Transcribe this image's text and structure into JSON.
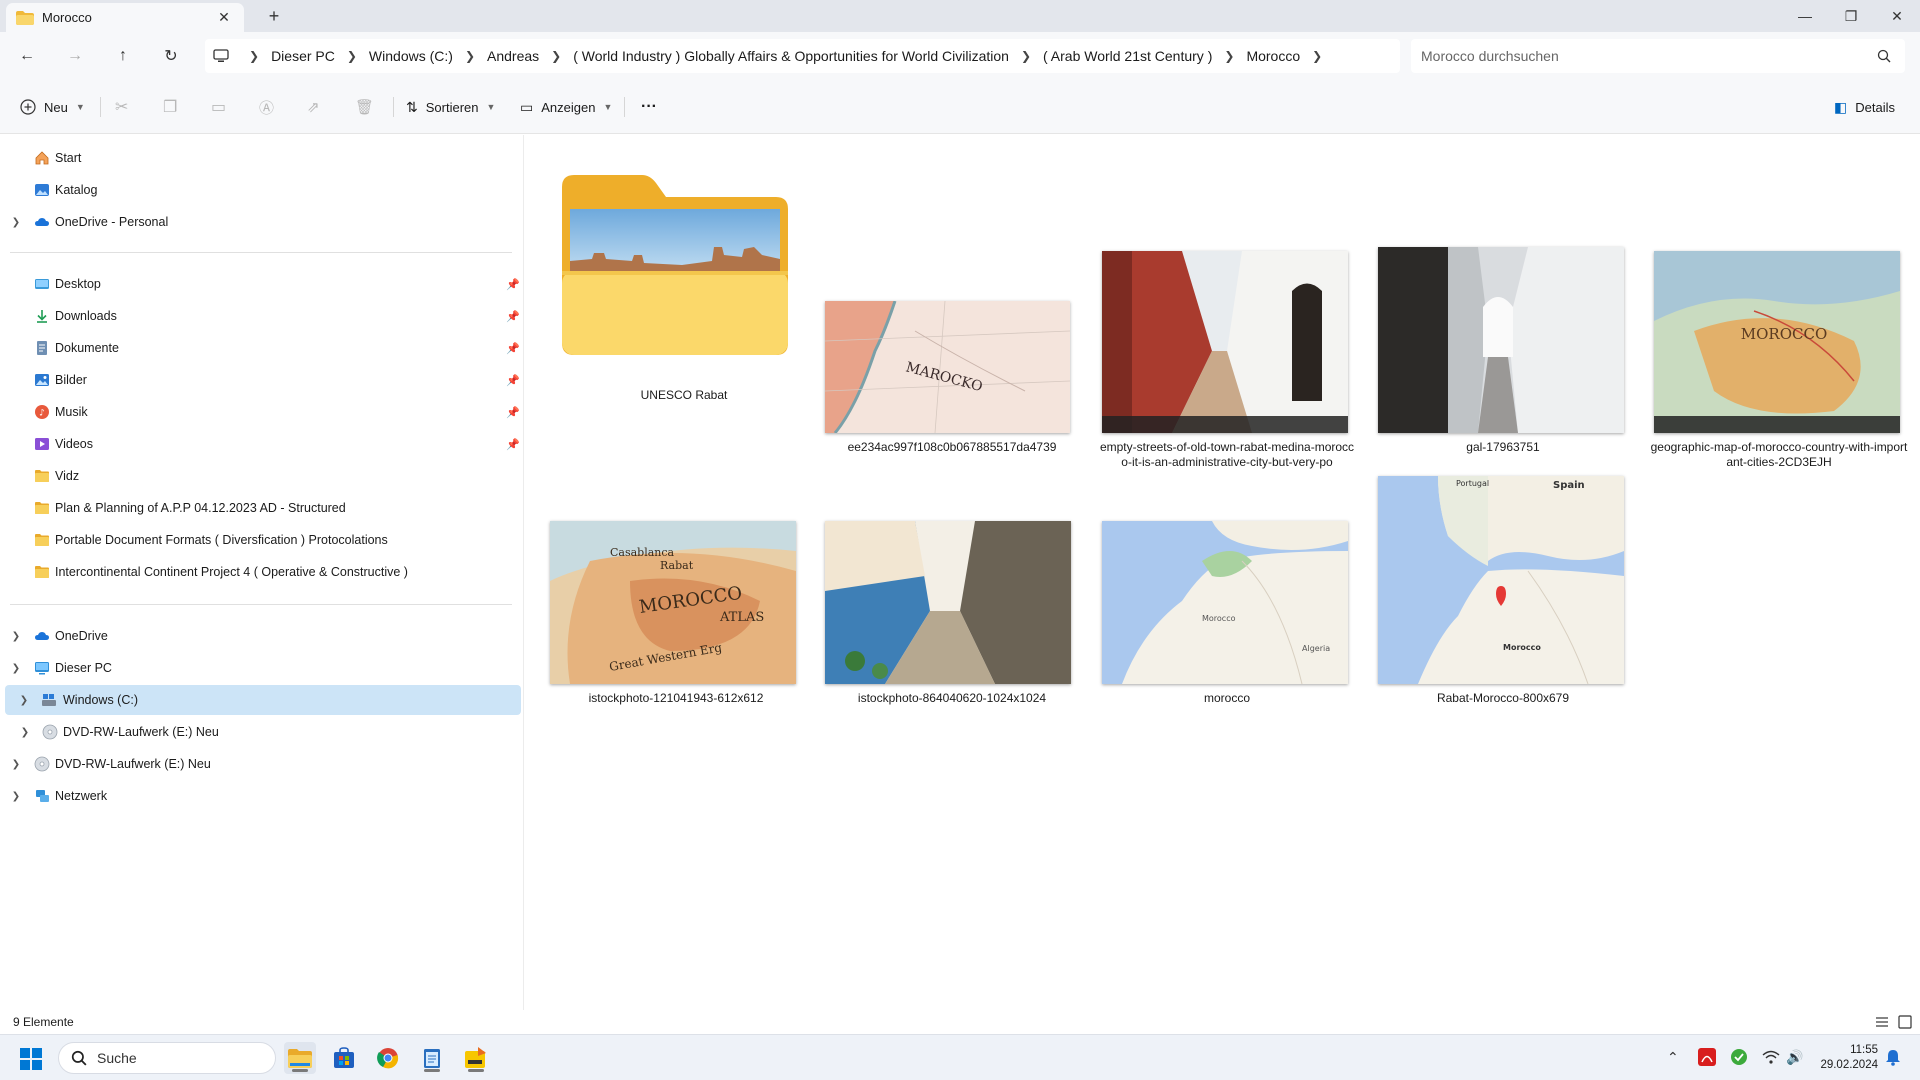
{
  "window": {
    "tab_title": "Morocco",
    "tab_close": "✕",
    "new_tab": "+"
  },
  "address": {
    "crumbs": [
      "Dieser PC",
      "Windows (C:)",
      "Andreas",
      "( World Industry ) Globally Affairs & Opportunities for World Civilization",
      "( Arab World 21st Century )",
      "Morocco"
    ],
    "search_placeholder": "Morocco durchsuchen"
  },
  "toolbar": {
    "new_label": "Neu",
    "sort_label": "Sortieren",
    "view_label": "Anzeigen",
    "more_label": "···",
    "details_label": "Details"
  },
  "sidebar": {
    "items": [
      {
        "label": "Start"
      },
      {
        "label": "Katalog"
      },
      {
        "label": "OneDrive - Personal"
      },
      {
        "label": "Desktop"
      },
      {
        "label": "Downloads"
      },
      {
        "label": "Dokumente"
      },
      {
        "label": "Bilder"
      },
      {
        "label": "Musik"
      },
      {
        "label": "Videos"
      },
      {
        "label": "Vidz"
      },
      {
        "label": "Plan  & Planning of A.P.P 04.12.2023 AD - Structured"
      },
      {
        "label": "Portable Document Formats ( Diversfication ) Protocolations"
      },
      {
        "label": "Intercontinental Continent Project 4 ( Operative & Constructive )"
      },
      {
        "label": "OneDrive"
      },
      {
        "label": "Dieser PC"
      },
      {
        "label": "Windows (C:)"
      },
      {
        "label": "DVD-RW-Laufwerk (E:) Neu"
      },
      {
        "label": "DVD-RW-Laufwerk (E:) Neu"
      },
      {
        "label": "Netzwerk"
      }
    ]
  },
  "files": [
    {
      "name": "UNESCO Rabat"
    },
    {
      "name": "ee234ac997f108c0b067885517da4739"
    },
    {
      "name": "empty-streets-of-old-town-rabat-medina-morocco-it-is-an-administrative-city-but-very-po"
    },
    {
      "name": "gal-17963751"
    },
    {
      "name": "geographic-map-of-morocco-country-with-important-cities-2CD3EJH"
    },
    {
      "name": "istockphoto-121041943-612x612"
    },
    {
      "name": "istockphoto-864040620-1024x1024"
    },
    {
      "name": "morocco"
    },
    {
      "name": "Rabat-Morocco-800x679"
    }
  ],
  "thumb_text": {
    "marocko": "MAROCKO",
    "morocco_map": "MOROCCO",
    "atlas": "ATLAS",
    "great_erg": "Great Western Erg",
    "casablanca": "Casablanca",
    "rabat": "Rabat",
    "spain": "Spain",
    "portugal": "Portugal",
    "gmap_morocco": "Morocco",
    "algeria": "Algeria"
  },
  "status": {
    "count": "9 Elemente"
  },
  "taskbar": {
    "search_label": "Suche",
    "time": "11:55",
    "date": "29.02.2024"
  },
  "colors": {
    "accent": "#0067c0",
    "selection": "#cce4f7",
    "folder": "#f4c542"
  }
}
